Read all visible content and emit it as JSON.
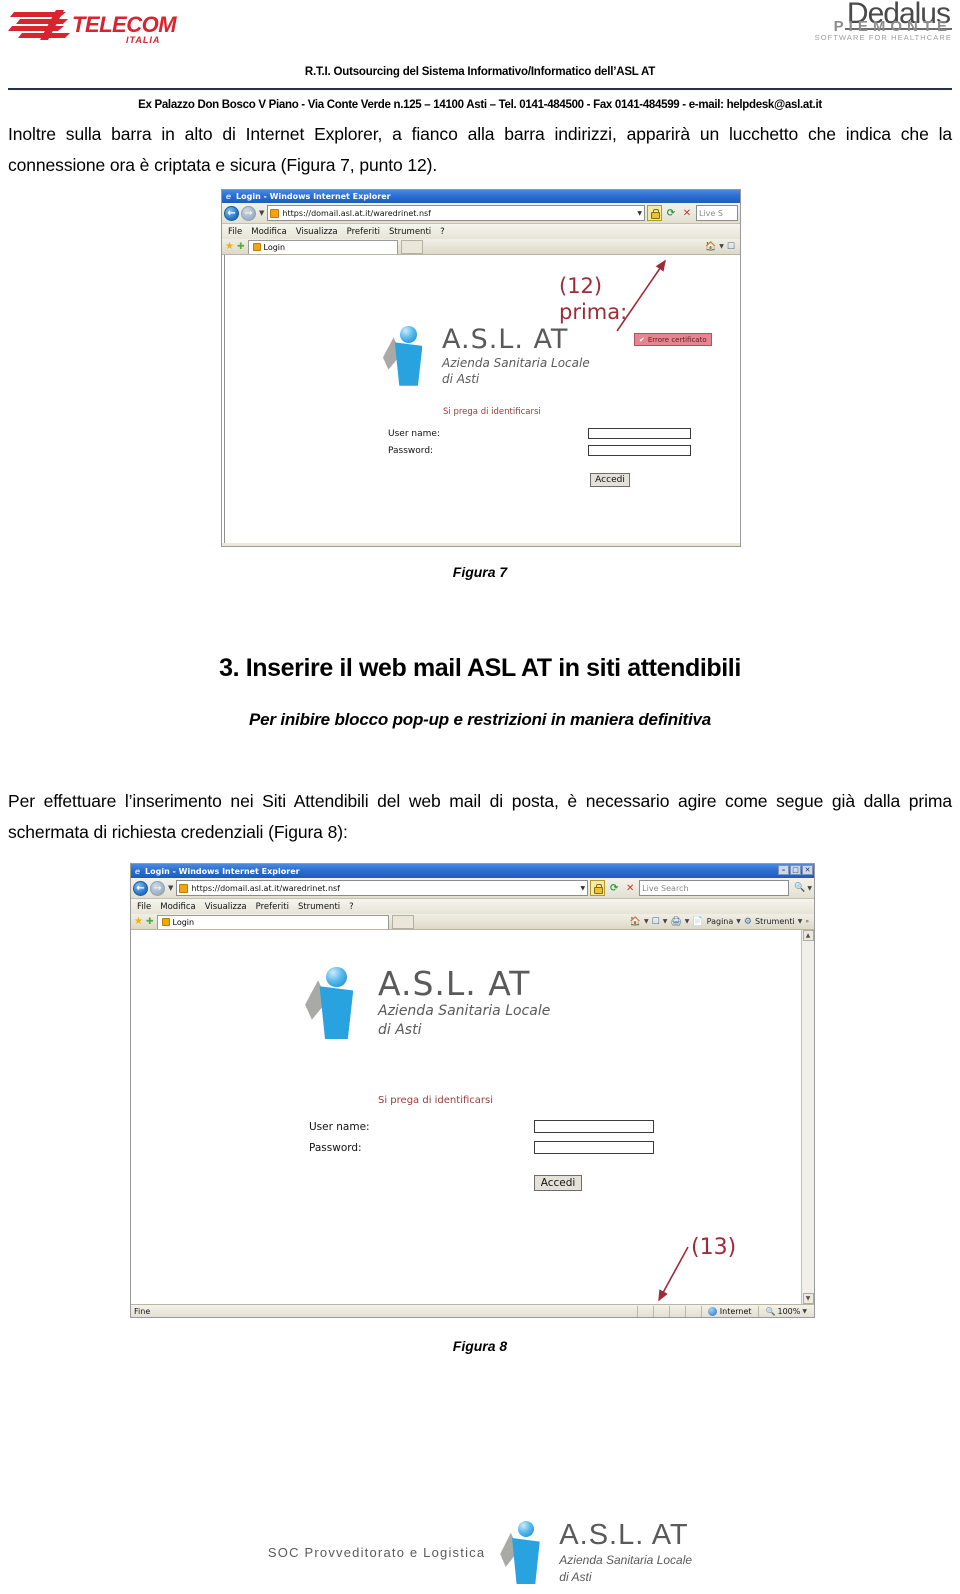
{
  "header": {
    "telecom_logo": "TELECOM",
    "telecom_sub": "ITALIA",
    "dedalus_logo": "Dedalus",
    "dedalus_sub1": "PIEMONTE",
    "dedalus_sub2": "SOFTWARE FOR HEALTHCARE",
    "rti_line": "R.T.I. Outsourcing del Sistema Informativo/Informatico dell’ASL AT",
    "address_line": "Ex Palazzo Don Bosco V Piano - Via Conte Verde n.125 – 14100 Asti – Tel. 0141-484500 - Fax 0141-484599 - e-mail: helpdesk@asl.at.it"
  },
  "body": {
    "intro_paragraph": "Inoltre sulla barra in alto di Internet Explorer, a fianco alla barra indirizzi, apparirà un lucchetto che indica che la connessione ora è criptata e sicura (Figura 7, punto 12).",
    "figure7_caption": "Figura 7",
    "section_number_title": "3. Inserire il web mail ASL AT in siti attendibili",
    "section_subtitle": "Per inibire blocco pop-up e restrizioni in maniera definitiva",
    "second_paragraph": "Per effettuare l’inserimento nei Siti Attendibili del web mail di posta, è necessario agire come segue già dalla prima schermata di richiesta credenziali (Figura 8):",
    "figure8_caption": "Figura 8"
  },
  "figure7": {
    "window_title": "Login - Windows Internet Explorer",
    "url": "https://domail.asl.at.it/waredrinet.nsf",
    "menu": [
      "File",
      "Modifica",
      "Visualizza",
      "Preferiti",
      "Strumenti",
      "?"
    ],
    "tab_label": "Login",
    "search_placeholder": "Live S",
    "annotation_number": "(12)",
    "annotation_label": "prima:",
    "cert_error_badge": "Errore certificato",
    "page": {
      "logo_title": "A.S.L. AT",
      "logo_sub1": "Azienda Sanitaria Locale",
      "logo_sub2": "di Asti",
      "prompt": "Si prega di identificarsi",
      "username_label": "User name:",
      "password_label": "Password:",
      "username_value": "",
      "password_value": "",
      "submit_label": "Accedi"
    }
  },
  "figure8": {
    "window_title": "Login - Windows Internet Explorer",
    "url": "https://domail.asl.at.it/waredrinet.nsf",
    "menu": [
      "File",
      "Modifica",
      "Visualizza",
      "Preferiti",
      "Strumenti",
      "?"
    ],
    "tab_label": "Login",
    "search_placeholder": "Live Search",
    "command_bar": [
      "Pagina",
      "Strumenti"
    ],
    "annotation_number": "(13)",
    "window_buttons": [
      "–",
      "□",
      "✕"
    ],
    "status": {
      "left_text": "Fine",
      "zone": "Internet",
      "zoom": "100%"
    },
    "page": {
      "logo_title": "A.S.L. AT",
      "logo_sub1": "Azienda Sanitaria Locale",
      "logo_sub2": "di Asti",
      "prompt": "Si prega di identificarsi",
      "username_label": "User name:",
      "password_label": "Password:",
      "username_value": "",
      "password_value": "",
      "submit_label": "Accedi"
    }
  },
  "footer": {
    "soc_text": "SOC Provveditorato e Logistica",
    "logo_title": "A.S.L. AT",
    "logo_sub1": "Azienda Sanitaria Locale",
    "logo_sub2": "di Asti"
  },
  "colors": {
    "telecom_red": "#d9232e",
    "rule_blue": "#26304a",
    "annotation_red": "#a02b38",
    "asl_blue": "#29a3e0"
  }
}
